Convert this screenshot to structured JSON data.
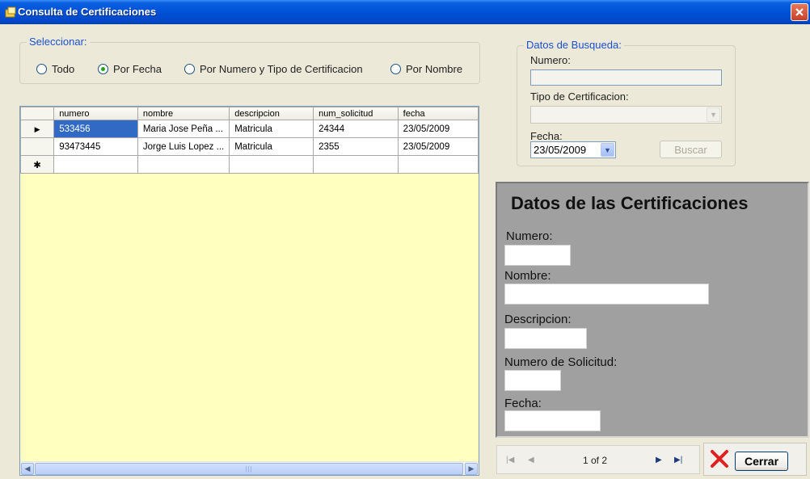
{
  "window": {
    "title": "Consulta de Certificaciones"
  },
  "select_group": {
    "legend": "Seleccionar:",
    "options": [
      {
        "label": "Todo",
        "checked": false
      },
      {
        "label": "Por Fecha",
        "checked": true
      },
      {
        "label": "Por Numero y Tipo de Certificacion",
        "checked": false
      },
      {
        "label": "Por Nombre",
        "checked": false
      }
    ]
  },
  "search": {
    "legend": "Datos de Busqueda:",
    "numero_label": "Numero:",
    "numero_value": "",
    "tipo_label": "Tipo de Certificacion:",
    "tipo_value": "",
    "fecha_label": "Fecha:",
    "fecha_value": "23/05/2009",
    "buscar_label": "Buscar"
  },
  "grid": {
    "columns": [
      "numero",
      "nombre",
      "descripcion",
      "num_solicitud",
      "fecha"
    ],
    "rows": [
      [
        "533456",
        "Maria Jose Peña ...",
        "Matricula",
        "24344",
        "23/05/2009"
      ],
      [
        "93473445",
        "Jorge Luis Lopez ...",
        "Matricula",
        "2355",
        "23/05/2009"
      ]
    ],
    "current_row_marker": "▶",
    "new_row_marker": "✱"
  },
  "detail": {
    "heading": "Datos de las Certificaciones",
    "numero_label": "Numero:",
    "nombre_label": "Nombre:",
    "descripcion_label": "Descripcion:",
    "solicitud_label": "Numero de Solicitud:",
    "fecha_label": "Fecha:"
  },
  "navigator": {
    "position": "1 of 2"
  },
  "actions": {
    "cerrar_label": "Cerrar"
  },
  "colors": {
    "titlebar": "#0052d6",
    "grid_background": "#ffffc0",
    "selection": "#316ac5",
    "detail_panel": "#a0a0a0",
    "legend": "#1a50d0"
  }
}
